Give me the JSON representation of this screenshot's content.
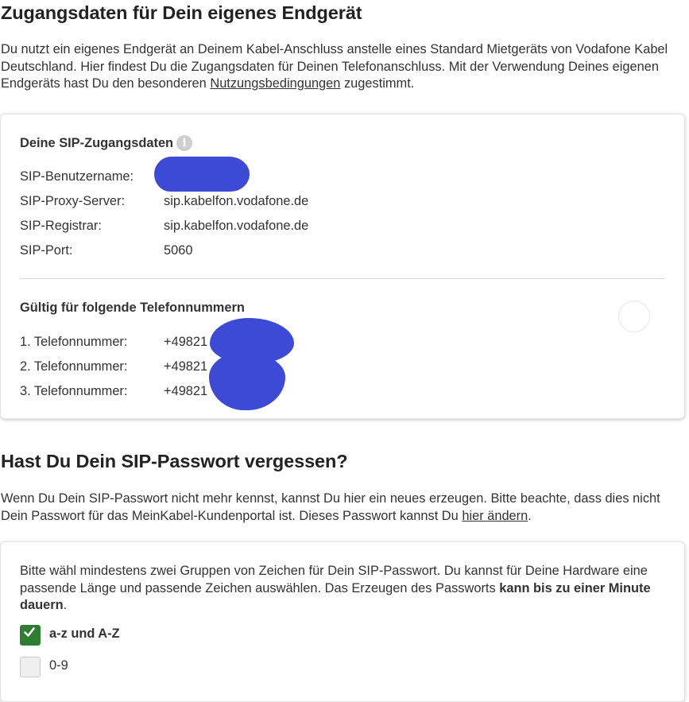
{
  "section1": {
    "title": "Zugangsdaten für Dein eigenes Endgerät",
    "intro_part1": "Du nutzt ein eigenes Endgerät an Deinem Kabel-Anschluss anstelle eines Standard Mietgeräts von Vodafone Kabel Deutschland. Hier findest Du die Zugangsdaten für Deinen Telefonanschluss. Mit der Verwendung Deines eigenen Endgeräts hast Du den besonderen ",
    "intro_link": "Nutzungsbedingungen",
    "intro_part2": " zugestimmt."
  },
  "sip_card": {
    "title": "Deine SIP-Zugangsdaten",
    "info_icon": "i",
    "rows": [
      {
        "label": "SIP-Benutzername:",
        "value": ""
      },
      {
        "label": "SIP-Proxy-Server:",
        "value": "sip.kabelfon.vodafone.de"
      },
      {
        "label": "SIP-Registrar:",
        "value": "sip.kabelfon.vodafone.de"
      },
      {
        "label": "SIP-Port:",
        "value": "5060"
      }
    ],
    "numbers_title": "Gültig für folgende Telefonnummern",
    "numbers": [
      {
        "label": "1. Telefonnummer:",
        "value": "+49821"
      },
      {
        "label": "2. Telefonnummer:",
        "value": "+49821"
      },
      {
        "label": "3. Telefonnummer:",
        "value": "+49821"
      }
    ]
  },
  "section2": {
    "title": "Hast Du Dein SIP-Passwort vergessen?",
    "text_part1": "Wenn Du Dein SIP-Passwort nicht mehr kennst, kannst Du hier ein neues erzeugen. Bitte beachte, dass dies nicht Dein Passwort für das MeinKabel-Kundenportal ist. Dieses Passwort kannst Du ",
    "text_link": "hier ändern",
    "text_part2": "."
  },
  "password_card": {
    "text_part1": "Bitte wähl mindestens zwei Gruppen von Zeichen für Dein SIP-Passwort. Du kannst für Deine Hardware eine passende Länge und passende Zeichen auswählen. Das Erzeugen des Passworts ",
    "text_bold": "kann bis zu einer Minute dauern",
    "text_part2": ".",
    "options": [
      {
        "label": "a-z und A-Z",
        "checked": true
      },
      {
        "label": "0-9",
        "checked": false
      }
    ]
  },
  "colors": {
    "checkbox_checked": "#2e7d32",
    "redaction": "#3d4ad6"
  }
}
